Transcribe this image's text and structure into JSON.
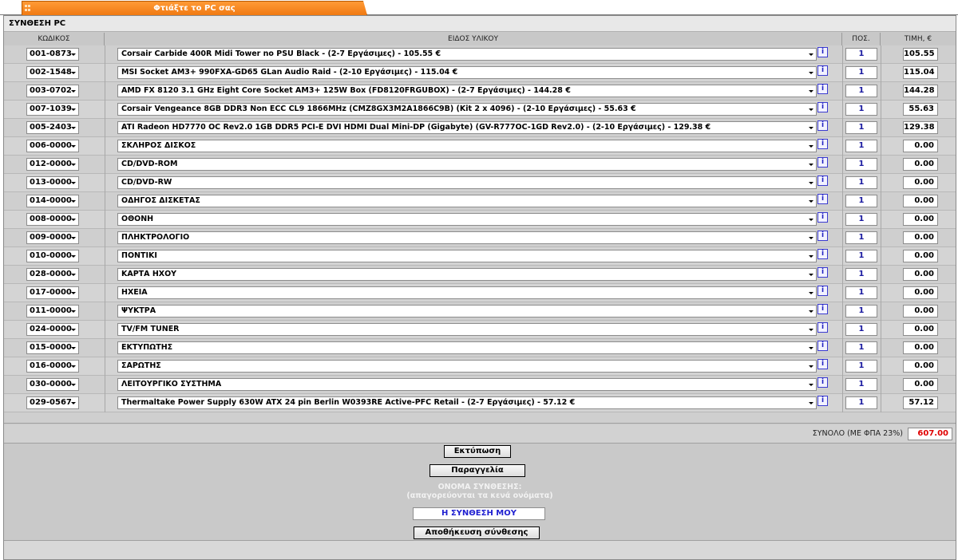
{
  "tab": {
    "label": "Φτιάξτε το PC σας"
  },
  "panel": {
    "title": "ΣΥΝΘΕΣΗ PC"
  },
  "columns": {
    "code": "ΚΩΔΙΚΟΣ",
    "item": "ΕΙΔΟΣ ΥΛΙΚΟΥ",
    "qty": "ΠΟΣ.",
    "price": "ΤΙΜΗ, €"
  },
  "info_symbol": "i",
  "rows": [
    {
      "code": "001-0873",
      "item": "Corsair Carbide 400R Midi Tower no PSU Black - (2-7 Εργάσιμες) - 105.55 €",
      "qty": "1",
      "price": "105.55"
    },
    {
      "code": "002-1548",
      "item": "MSI Socket AM3+ 990FXA-GD65 GLan Audio Raid - (2-10 Εργάσιμες) - 115.04 €",
      "qty": "1",
      "price": "115.04"
    },
    {
      "code": "003-0702",
      "item": "AMD FX 8120 3.1 GHz Eight Core Socket AM3+ 125W Box (FD8120FRGUBOX) - (2-7 Εργάσιμες) - 144.28 €",
      "qty": "1",
      "price": "144.28"
    },
    {
      "code": "007-1039",
      "item": "Corsair Vengeance 8GB DDR3 Non ECC CL9 1866MHz (CMZ8GX3M2A1866C9B) (Kit 2 x 4096) - (2-10 Εργάσιμες) - 55.63 €",
      "qty": "1",
      "price": "55.63"
    },
    {
      "code": "005-2403",
      "item": "ATI Radeon HD7770 OC Rev2.0 1GB DDR5 PCI-E DVI HDMI Dual Mini-DP (Gigabyte) (GV-R777OC-1GD Rev2.0) - (2-10 Εργάσιμες) - 129.38 €",
      "qty": "1",
      "price": "129.38"
    },
    {
      "code": "006-0000",
      "item": "ΣΚΛΗΡΟΣ ΔΙΣΚΟΣ",
      "qty": "1",
      "price": "0.00"
    },
    {
      "code": "012-0000",
      "item": "CD/DVD-ROM",
      "qty": "1",
      "price": "0.00"
    },
    {
      "code": "013-0000",
      "item": "CD/DVD-RW",
      "qty": "1",
      "price": "0.00"
    },
    {
      "code": "014-0000",
      "item": "ΟΔΗΓΟΣ ΔΙΣΚΕΤΑΣ",
      "qty": "1",
      "price": "0.00"
    },
    {
      "code": "008-0000",
      "item": "ΟΘΟΝΗ",
      "qty": "1",
      "price": "0.00"
    },
    {
      "code": "009-0000",
      "item": "ΠΛΗΚΤΡΟΛΟΓΙΟ",
      "qty": "1",
      "price": "0.00"
    },
    {
      "code": "010-0000",
      "item": "ΠΟΝΤΙΚΙ",
      "qty": "1",
      "price": "0.00"
    },
    {
      "code": "028-0000",
      "item": "ΚΑΡΤΑ ΗΧΟΥ",
      "qty": "1",
      "price": "0.00"
    },
    {
      "code": "017-0000",
      "item": "ΗΧΕΙΑ",
      "qty": "1",
      "price": "0.00"
    },
    {
      "code": "011-0000",
      "item": "ΨΥΚΤΡΑ",
      "qty": "1",
      "price": "0.00"
    },
    {
      "code": "024-0000",
      "item": "TV/FM TUNER",
      "qty": "1",
      "price": "0.00"
    },
    {
      "code": "015-0000",
      "item": "ΕΚΤΥΠΩΤΗΣ",
      "qty": "1",
      "price": "0.00"
    },
    {
      "code": "016-0000",
      "item": "ΣΑΡΩΤΗΣ",
      "qty": "1",
      "price": "0.00"
    },
    {
      "code": "030-0000",
      "item": "ΛΕΙΤΟΥΡΓΙΚΟ ΣΥΣΤΗΜΑ",
      "qty": "1",
      "price": "0.00"
    },
    {
      "code": "029-0567",
      "item": "Thermaltake Power Supply 630W ATX 24 pin Berlin W0393RE Active-PFC Retail - (2-7 Εργάσιμες) - 57.12 €",
      "qty": "1",
      "price": "57.12"
    }
  ],
  "total": {
    "label": "ΣΥΝΟΛΟ (ΜΕ ΦΠΑ 23%)",
    "value": "607.00"
  },
  "actions": {
    "print_label": "Εκτύπωση",
    "order_label": "Παραγγελία",
    "name_caption": "ΟΝΟΜΑ ΣΥΝΘΕΣΗΣ:",
    "name_hint": "(απαγορεύονται τα κενά ονόματα)",
    "name_value": "Η ΣΥΝΘΕΣΗ ΜΟΥ",
    "save_label": "Αποθήκευση σύνθεσης"
  },
  "colors": {
    "tab": "#f07a12",
    "total_value": "#e00000",
    "link_blue": "#1f1fd0"
  }
}
